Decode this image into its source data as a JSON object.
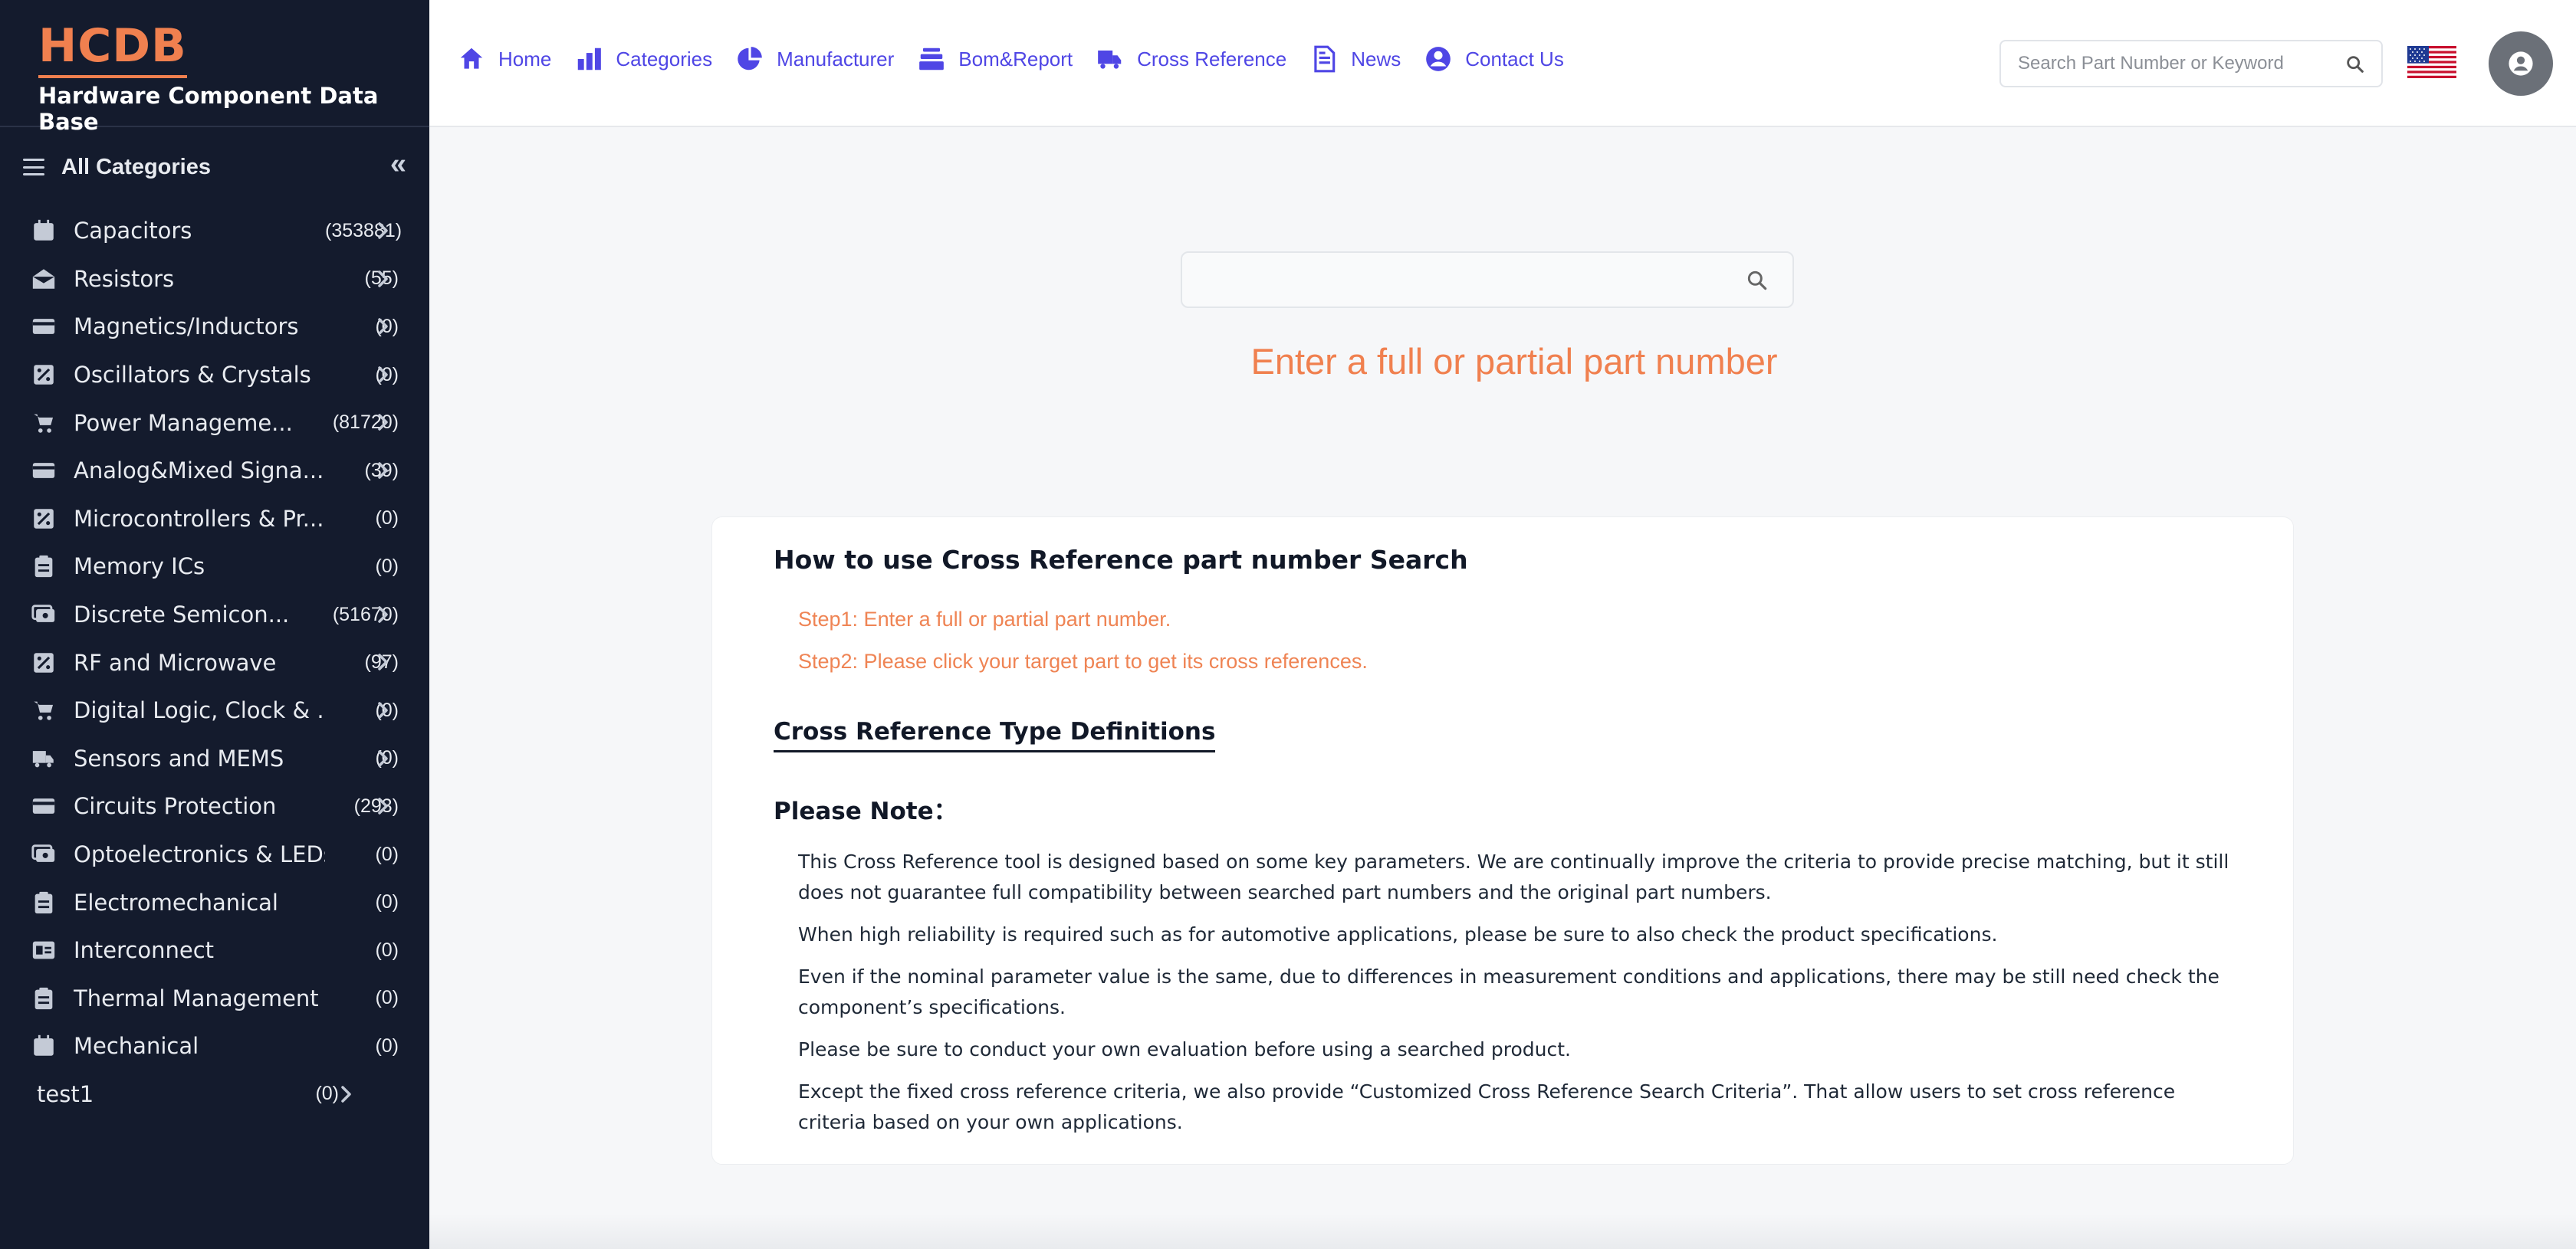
{
  "brand": {
    "logo": "HCDB",
    "subtitle": "Hardware Component Data Base"
  },
  "sidebar": {
    "all_categories_label": "All Categories",
    "categories": [
      {
        "name": "Capacitors",
        "count": "(353881)",
        "icon": "calendar-icon",
        "chevron": true
      },
      {
        "name": "Resistors",
        "count": "(55)",
        "icon": "envelope-open-icon",
        "chevron": true
      },
      {
        "name": "Magnetics/Inductors",
        "count": "(0)",
        "icon": "card-icon",
        "chevron": true
      },
      {
        "name": "Oscillators & Crystals",
        "count": "(0)",
        "icon": "percent-box-icon",
        "chevron": true
      },
      {
        "name": "Power Manageme...",
        "count": "(81720)",
        "icon": "cart-icon",
        "chevron": true
      },
      {
        "name": "Analog&Mixed Signa...",
        "count": "(39)",
        "icon": "card-icon",
        "chevron": true
      },
      {
        "name": "Microcontrollers & Pr...",
        "count": "(0)",
        "icon": "percent-box-icon",
        "chevron": false
      },
      {
        "name": "Memory ICs",
        "count": "(0)",
        "icon": "clipboard-icon",
        "chevron": false
      },
      {
        "name": "Discrete Semicon...",
        "count": "(51670)",
        "icon": "cash-icon",
        "chevron": true
      },
      {
        "name": "RF and Microwave",
        "count": "(97)",
        "icon": "percent-box-icon",
        "chevron": true
      },
      {
        "name": "Digital Logic, Clock & ...",
        "count": "(0)",
        "icon": "cart-icon",
        "chevron": true
      },
      {
        "name": "Sensors and MEMS",
        "count": "(0)",
        "icon": "truck-icon",
        "chevron": true
      },
      {
        "name": "Circuits Protection",
        "count": "(293)",
        "icon": "card-icon",
        "chevron": true
      },
      {
        "name": "Optoelectronics & LEDs",
        "count": "(0)",
        "icon": "cash-icon",
        "chevron": false
      },
      {
        "name": "Electromechanical",
        "count": "(0)",
        "icon": "clipboard-icon",
        "chevron": false
      },
      {
        "name": "Interconnect",
        "count": "(0)",
        "icon": "id-card-icon",
        "chevron": false
      },
      {
        "name": "Thermal Management",
        "count": "(0)",
        "icon": "clipboard-icon",
        "chevron": false
      },
      {
        "name": "Mechanical",
        "count": "(0)",
        "icon": "calendar-icon",
        "chevron": false
      },
      {
        "name": "test1",
        "count": "(0)",
        "icon": "",
        "chevron": true
      }
    ]
  },
  "header": {
    "nav": [
      {
        "label": "Home",
        "icon": "home-icon"
      },
      {
        "label": "Categories",
        "icon": "bar-chart-icon"
      },
      {
        "label": "Manufacturer",
        "icon": "pie-chart-icon"
      },
      {
        "label": "Bom&Report",
        "icon": "stack-icon"
      },
      {
        "label": "Cross Reference",
        "icon": "truck-icon"
      },
      {
        "label": "News",
        "icon": "document-icon"
      },
      {
        "label": "Contact Us",
        "icon": "user-circle-icon"
      }
    ],
    "search_placeholder": "Search Part Number or Keyword"
  },
  "main": {
    "search_value": "",
    "hint": "Enter a full or partial part number",
    "card": {
      "title": "How to use Cross Reference part number Search",
      "steps": [
        "Step1: Enter a full or partial part number.",
        "Step2: Please click your target part to get its cross references."
      ],
      "definitions_title": "Cross Reference Type Definitions",
      "note_title": "Please Note：",
      "notes": [
        "This Cross Reference tool is designed based on some key parameters. We are continually improve the criteria to provide precise matching, but it still does not guarantee full compatibility between searched part numbers and the original part numbers.",
        "When high reliability is required such as for automotive applications, please be sure to also check the product specifications.",
        "Even if the nominal parameter value is the same, due to differences in measurement conditions and applications, there may be still need check the component’s specifications.",
        "Please be sure to conduct your own evaluation before using a searched product.",
        "Except the fixed cross reference criteria, we also provide “Customized Cross Reference Search Criteria”. That allow users to set cross reference criteria based on your own applications."
      ]
    }
  },
  "colors": {
    "accent": "#4f46e5",
    "brand": "#f0804f",
    "sidebar_bg": "#141b2d"
  }
}
